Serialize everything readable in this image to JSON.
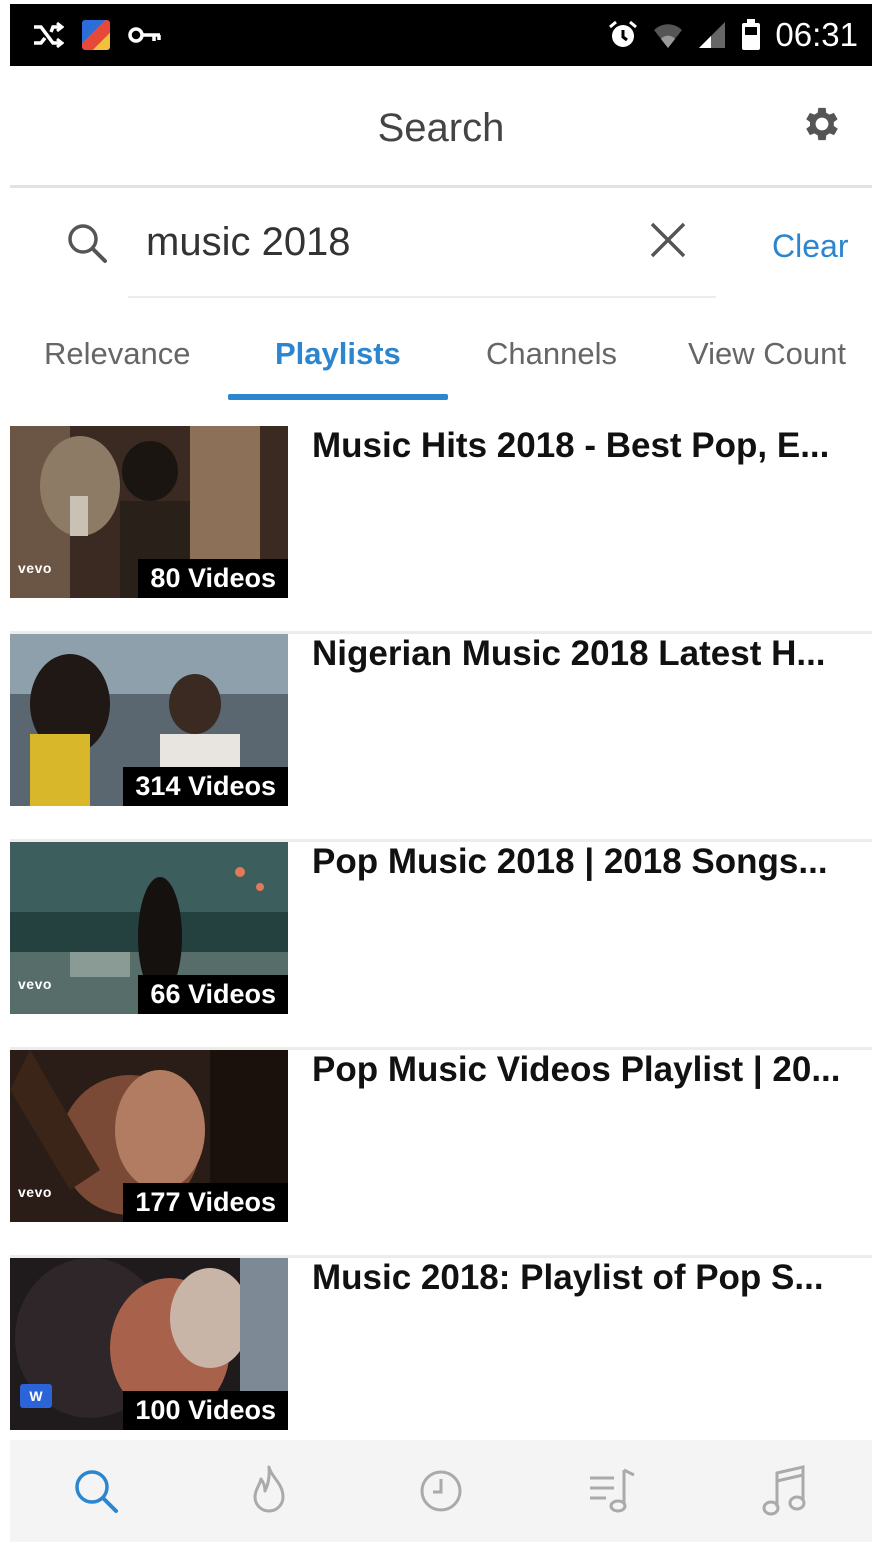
{
  "status_bar": {
    "time": "06:31",
    "left_icons": [
      "shuffle-icon",
      "app-icon",
      "key-icon"
    ],
    "right_icons": [
      "alarm-icon",
      "wifi-icon",
      "signal-icon",
      "battery-icon"
    ]
  },
  "header": {
    "title": "Search",
    "settings_icon": "gear-icon"
  },
  "search": {
    "query": "music 2018",
    "clear_label": "Clear"
  },
  "tabs": [
    {
      "label": "Relevance",
      "active": false
    },
    {
      "label": "Playlists",
      "active": true
    },
    {
      "label": "Channels",
      "active": false
    },
    {
      "label": "View Count",
      "active": false
    }
  ],
  "results": [
    {
      "title": "Music Hits 2018 - Best Pop, E...",
      "count": "80 Videos",
      "brand": "vevo"
    },
    {
      "title": "Nigerian Music 2018 Latest H...",
      "count": "314 Videos",
      "brand": ""
    },
    {
      "title": "Pop Music 2018 | 2018 Songs...",
      "count": "66 Videos",
      "brand": "vevo"
    },
    {
      "title": "Pop Music Videos Playlist | 20...",
      "count": "177 Videos",
      "brand": "vevo"
    },
    {
      "title": "Music 2018: Playlist of Pop S...",
      "count": "100 Videos",
      "brand": "W"
    }
  ],
  "bottom_nav": [
    {
      "icon": "search-icon",
      "active": true
    },
    {
      "icon": "flame-icon",
      "active": false
    },
    {
      "icon": "clock-icon",
      "active": false
    },
    {
      "icon": "queue-music-icon",
      "active": false
    },
    {
      "icon": "music-note-icon",
      "active": false
    }
  ],
  "colors": {
    "accent": "#2b86cf",
    "status_bar_bg": "#000000",
    "nav_bg": "#f4f4f4"
  }
}
